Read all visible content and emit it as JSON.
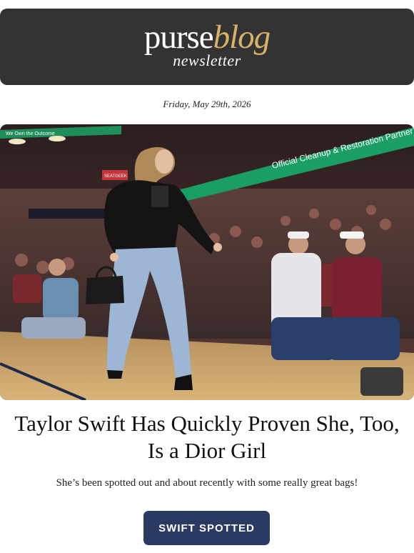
{
  "header": {
    "logo_purse": "purse",
    "logo_blog": "blog",
    "logo_sub": "newsletter",
    "bg_color": "#333333",
    "accent_color": "#d7b36a"
  },
  "date": "Friday, May 29th, 2026",
  "hero": {
    "signs": {
      "banner_right": "Official Cleanup & Restoration Partner",
      "banner_left": "We Own the Outcome",
      "seatgeek": "SEATGEEK"
    }
  },
  "article": {
    "headline": "Taylor Swift Has Quickly Proven She, Too, Is a Dior Girl",
    "subtext": "She’s been spotted out and about recently with some really great bags!"
  },
  "cta": {
    "label": "SWIFT SPOTTED",
    "color": "#2a3a62"
  }
}
